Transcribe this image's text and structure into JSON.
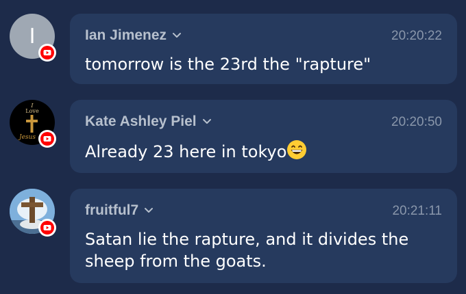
{
  "messages": [
    {
      "author": "Ian Jimenez",
      "avatar_letter": "I",
      "time": "20:20:22",
      "text": "tomorrow is the 23rd the \"rapture\"",
      "platform_icon": "youtube-icon"
    },
    {
      "author": "Kate Ashley Piel",
      "avatar_text_top": "I",
      "avatar_text_mid": "Love",
      "avatar_text_bottom": "Jesus",
      "time": "20:20:50",
      "text": "Already 23 here in tokyo",
      "emoji": "grinning-face-icon",
      "platform_icon": "youtube-icon"
    },
    {
      "author": "fruitful7",
      "time": "20:21:11",
      "text": "Satan lie the rapture, and it divides the sheep from the goats.",
      "platform_icon": "youtube-icon"
    }
  ],
  "colors": {
    "background": "#1d2b4a",
    "bubble": "#263a5e",
    "author": "#b7c0cd",
    "time": "#8a97ab",
    "text": "#ffffff",
    "youtube_red": "#ff0000"
  }
}
